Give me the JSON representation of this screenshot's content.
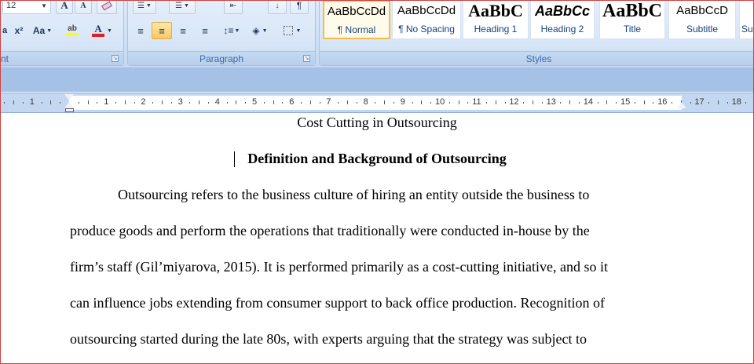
{
  "font": {
    "size_value": "12",
    "grow_label": "A",
    "shrink_label": "A",
    "superscript_label": "x²",
    "change_case_label": "Aa",
    "highlight_label": "ab",
    "font_color_label": "A",
    "group_label": "nt"
  },
  "paragraph": {
    "group_label": "Paragraph"
  },
  "styles": {
    "group_label": "Styles",
    "items": [
      {
        "sample": "AaBbCcDd",
        "name": "¶ Normal"
      },
      {
        "sample": "AaBbCcDd",
        "name": "¶ No Spacing"
      },
      {
        "sample": "AaBbC",
        "name": "Heading 1"
      },
      {
        "sample": "AaBbCc",
        "name": "Heading 2"
      },
      {
        "sample": "AaBbC",
        "name": "Title"
      },
      {
        "sample": "AaBbCcD",
        "name": "Subtitle"
      },
      {
        "sample": "",
        "name": "Su"
      }
    ]
  },
  "ruler": {
    "numbers": [
      "1",
      "1",
      "2",
      "3",
      "4",
      "5",
      "6",
      "7",
      "8",
      "9",
      "10",
      "11",
      "12",
      "13",
      "14",
      "15",
      "16",
      "17",
      "18"
    ]
  },
  "document": {
    "title": "Cost Cutting in Outsourcing",
    "heading": "Definition and Background  of Outsourcing",
    "lines": [
      "Outsourcing refers to the business culture of hiring an entity outside the business to",
      "produce goods and perform the operations that traditionally were conducted in-house by the",
      "firm’s staff (Gil’miyarova, 2015). It is performed primarily as a cost-cutting initiative, and so it",
      "can influence jobs extending from consumer support to back office production. Recognition of",
      "outsourcing started during the late 80s, with experts arguing that the strategy was subject to"
    ]
  },
  "colors": {
    "highlight": "#ffff00",
    "font_color": "#e02020",
    "accent": "#3e6aaa"
  }
}
